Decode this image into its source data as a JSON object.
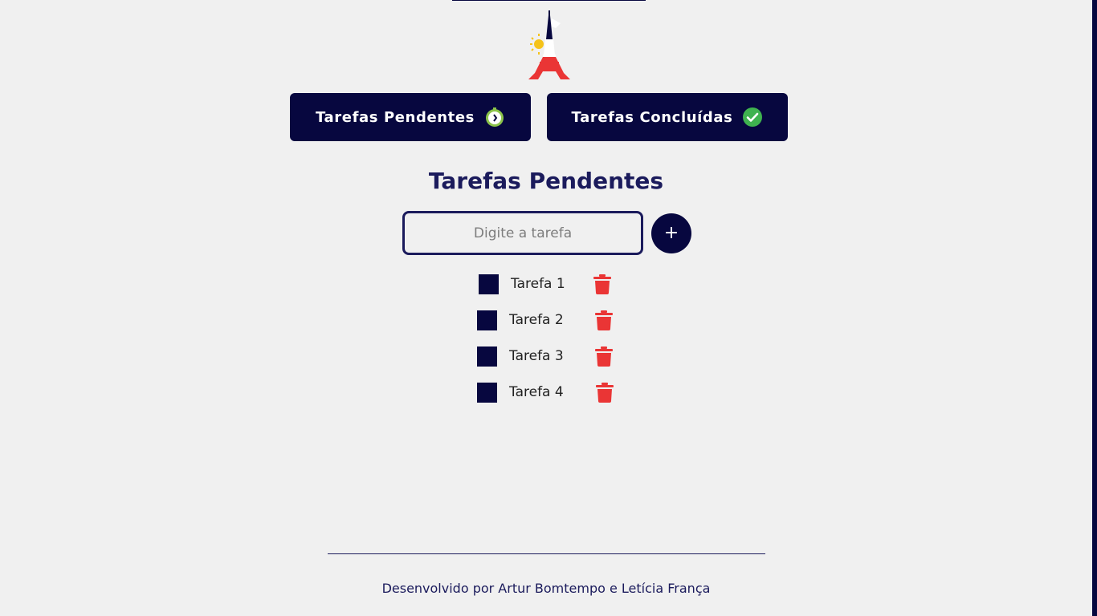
{
  "colors": {
    "primary": "#07073f",
    "title": "#1b1b5c",
    "danger": "#ea3535",
    "success": "#3fb24f",
    "background": "#f0f0f0"
  },
  "nav": {
    "pending_label": "Tarefas Pendentes",
    "pending_icon": "stopwatch-icon",
    "completed_label": "Tarefas Concluídas",
    "completed_icon": "check-circle-icon"
  },
  "main": {
    "title": "Tarefas Pendentes",
    "input_placeholder": "Digite a tarefa",
    "input_value": "",
    "add_label": "+"
  },
  "tasks": [
    {
      "label": "Tarefa 1"
    },
    {
      "label": "Tarefa 2"
    },
    {
      "label": "Tarefa 3"
    },
    {
      "label": "Tarefa 4"
    }
  ],
  "footer": {
    "text": "Desenvolvido por Artur Bomtempo e Letícia França"
  }
}
